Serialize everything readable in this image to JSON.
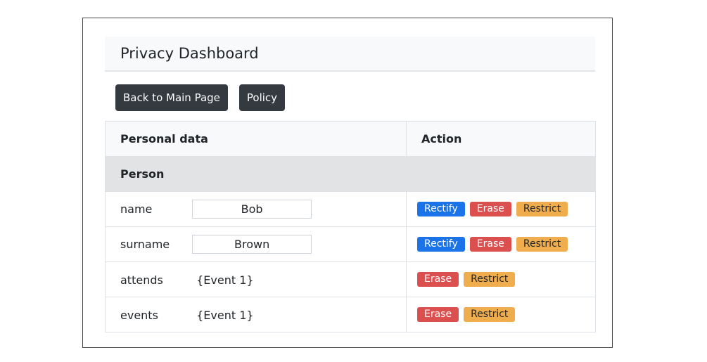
{
  "header": {
    "title": "Privacy Dashboard"
  },
  "toolbar": {
    "back_label": "Back to Main Page",
    "policy_label": "Policy"
  },
  "table": {
    "columns": [
      "Personal data",
      "Action"
    ],
    "group_label": "Person",
    "rows": [
      {
        "field": "name",
        "value": "Bob",
        "editable": true,
        "actions": [
          "Rectify",
          "Erase",
          "Restrict"
        ]
      },
      {
        "field": "surname",
        "value": "Brown",
        "editable": true,
        "actions": [
          "Rectify",
          "Erase",
          "Restrict"
        ]
      },
      {
        "field": "attends",
        "value": "{Event 1}",
        "editable": false,
        "actions": [
          "Erase",
          "Restrict"
        ]
      },
      {
        "field": "events",
        "value": "{Event 1}",
        "editable": false,
        "actions": [
          "Erase",
          "Restrict"
        ]
      }
    ]
  },
  "colors": {
    "rectify": "#1a73e8",
    "erase": "#dc4f4f",
    "restrict": "#f0ad4e",
    "button_dark": "#343a40"
  }
}
